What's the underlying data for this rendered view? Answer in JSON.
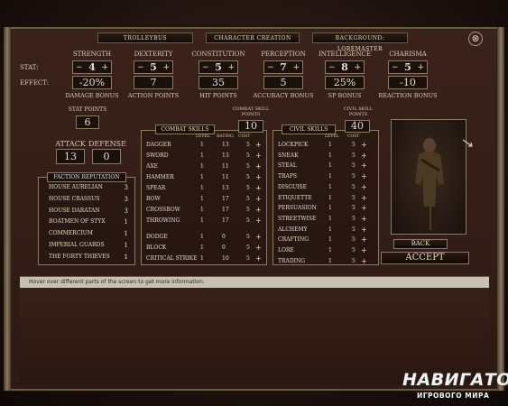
{
  "header": {
    "name": "TROLLEYBUS",
    "screen_title": "CHARACTER CREATION",
    "background": "BACKGROUND: LOREMASTER",
    "close_symbol": "⊗"
  },
  "rows": {
    "stat_label": "STAT:",
    "effect_label": "EFFECT:",
    "minus": "−",
    "plus": "+"
  },
  "attributes": [
    {
      "name": "STRENGTH",
      "value": "4",
      "effect": "-20%",
      "effect_label": "DAMAGE BONUS"
    },
    {
      "name": "DEXTERITY",
      "value": "5",
      "effect": "7",
      "effect_label": "ACTION POINTS"
    },
    {
      "name": "CONSTITUTION",
      "value": "5",
      "effect": "35",
      "effect_label": "HIT POINTS"
    },
    {
      "name": "PERCEPTION",
      "value": "7",
      "effect": "5",
      "effect_label": "ACCURACY BONUS"
    },
    {
      "name": "INTELLIGENCE",
      "value": "8",
      "effect": "25%",
      "effect_label": "SP BONUS"
    },
    {
      "name": "CHARISMA",
      "value": "5",
      "effect": "-10",
      "effect_label": "REACTION BONUS"
    }
  ],
  "stat_points": {
    "label": "STAT POINTS",
    "value": "6"
  },
  "attack": {
    "label": "ATTACK",
    "value": "13"
  },
  "defense": {
    "label": "DEFENSE",
    "value": "0"
  },
  "faction": {
    "title": "FACTION REPUTATION",
    "items": [
      {
        "name": "HOUSE AURELIAN",
        "value": "3"
      },
      {
        "name": "HOUSE CRASSUS",
        "value": "3"
      },
      {
        "name": "HOUSE DARATAN",
        "value": "3"
      },
      {
        "name": "BOATMEN OF STYX",
        "value": "1"
      },
      {
        "name": "COMMERCIUM",
        "value": "1"
      },
      {
        "name": "IMPERIAL GUARDS",
        "value": "1"
      },
      {
        "name": "THE FORTY THIEVES",
        "value": "1"
      }
    ]
  },
  "combat": {
    "title": "COMBAT SKILLS",
    "points_label": "COMBAT SKILL POINTS",
    "points": "10",
    "col_level": "LEVEL",
    "col_rating": "RATING",
    "col_cost": "COST",
    "skills": [
      {
        "name": "DAGGER",
        "level": "1",
        "rating": "13",
        "cost": "5"
      },
      {
        "name": "SWORD",
        "level": "1",
        "rating": "13",
        "cost": "5"
      },
      {
        "name": "AXE",
        "level": "1",
        "rating": "11",
        "cost": "5"
      },
      {
        "name": "HAMMER",
        "level": "1",
        "rating": "11",
        "cost": "5"
      },
      {
        "name": "SPEAR",
        "level": "1",
        "rating": "13",
        "cost": "5"
      },
      {
        "name": "BOW",
        "level": "1",
        "rating": "17",
        "cost": "5"
      },
      {
        "name": "CROSSBOW",
        "level": "1",
        "rating": "17",
        "cost": "5"
      },
      {
        "name": "THROWING",
        "level": "1",
        "rating": "17",
        "cost": "5"
      },
      {
        "name": "DODGE",
        "level": "1",
        "rating": "0",
        "cost": "5"
      },
      {
        "name": "BLOCK",
        "level": "1",
        "rating": "0",
        "cost": "5"
      },
      {
        "name": "CRITICAL STRIKE",
        "level": "1",
        "rating": "10",
        "cost": "5"
      }
    ]
  },
  "civil": {
    "title": "CIVIL SKILLS",
    "points_label": "CIVIL SKILL POINTS",
    "points": "40",
    "col_level": "LEVEL",
    "col_cost": "COST",
    "skills": [
      {
        "name": "LOCKPICK",
        "level": "1",
        "cost": "5"
      },
      {
        "name": "SNEAK",
        "level": "1",
        "cost": "5"
      },
      {
        "name": "STEAL",
        "level": "1",
        "cost": "5"
      },
      {
        "name": "TRAPS",
        "level": "1",
        "cost": "5"
      },
      {
        "name": "DISGUISE",
        "level": "1",
        "cost": "5"
      },
      {
        "name": "ETIQUETTE",
        "level": "1",
        "cost": "5"
      },
      {
        "name": "PERSUASION",
        "level": "1",
        "cost": "5"
      },
      {
        "name": "STREETWISE",
        "level": "1",
        "cost": "5"
      },
      {
        "name": "ALCHEMY",
        "level": "1",
        "cost": "5"
      },
      {
        "name": "CRAFTING",
        "level": "1",
        "cost": "5"
      },
      {
        "name": "LORE",
        "level": "1",
        "cost": "5"
      },
      {
        "name": "TRADING",
        "level": "1",
        "cost": "5"
      }
    ]
  },
  "buttons": {
    "back": "BACK",
    "accept": "ACCEPT"
  },
  "info_text": "Hover over different parts of the screen to get more information.",
  "watermark": {
    "line1": "НАВИГАТОР",
    "line2": "ИГРОВОГО МИРА"
  },
  "colors": {
    "panel_bg": "#2d1a15",
    "border": "#8a7a60",
    "text": "#e8dcc0"
  }
}
